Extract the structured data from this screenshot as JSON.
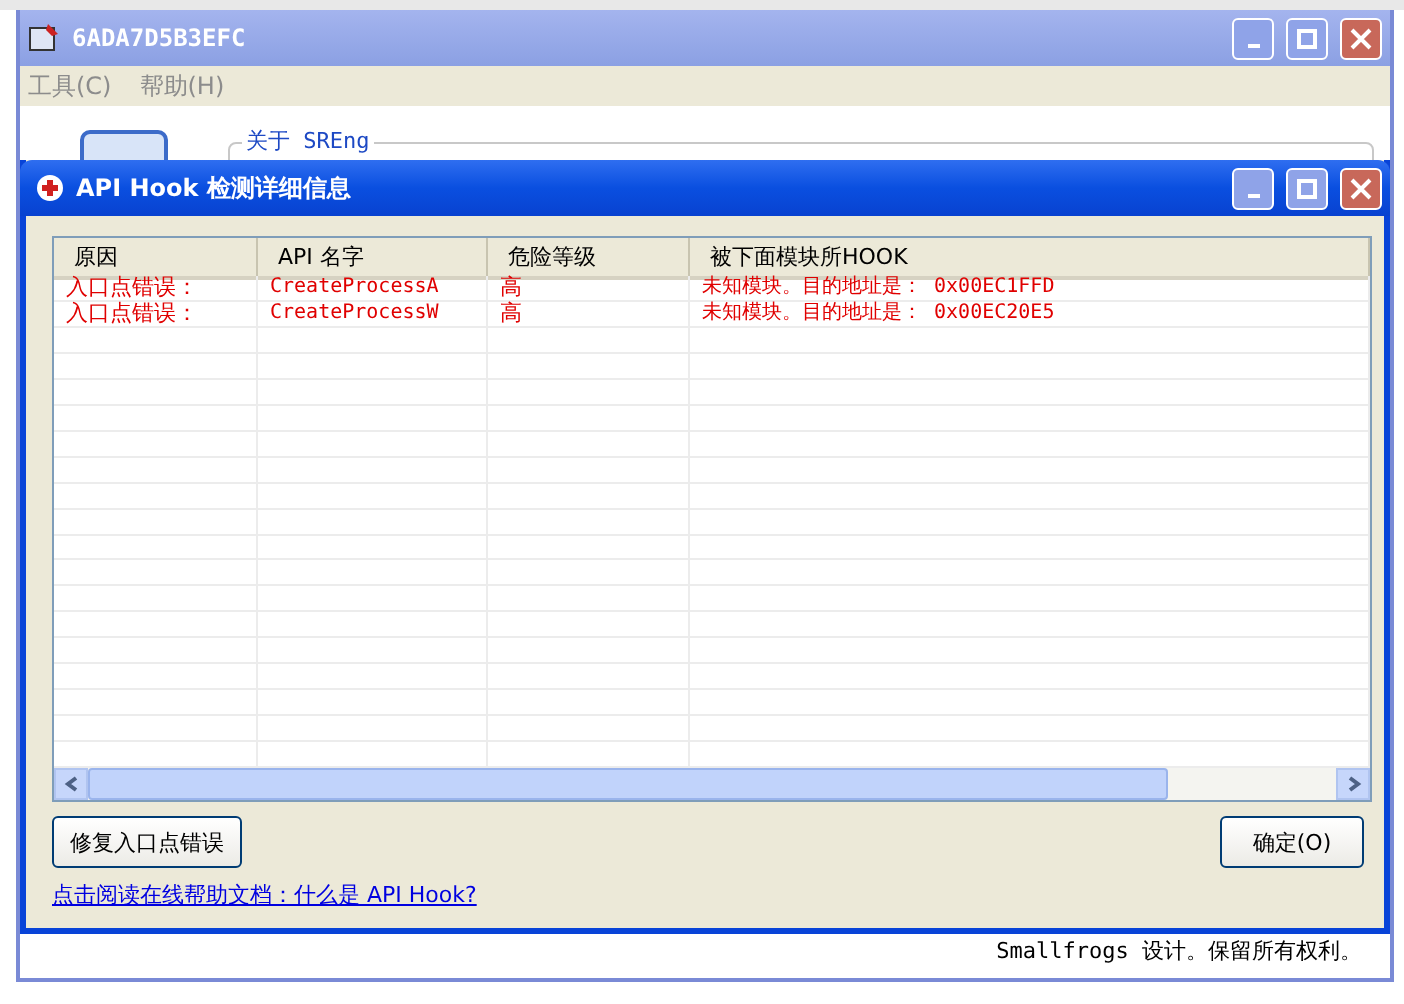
{
  "window": {
    "title": "6ADA7D5B3EFC"
  },
  "menu": [
    {
      "label": "工具(C)"
    },
    {
      "label": "帮助(H)"
    }
  ],
  "about_group": {
    "title": "关于 SREng"
  },
  "dialog": {
    "title": "API Hook 检测详细信息",
    "table": {
      "columns": [
        "原因",
        "API 名字",
        "危险等级",
        "被下面模块所HOOK"
      ],
      "rows": [
        [
          "入口点错误：",
          "CreateProcessA",
          "高",
          "未知模块。目的地址是： 0x00EC1FFD"
        ],
        [
          "入口点错误：",
          "CreateProcessW",
          "高",
          "未知模块。目的地址是： 0x00EC20E5"
        ]
      ]
    },
    "fix_button": "修复入口点错误",
    "ok_button": "确定(O)",
    "help_link": "点击阅读在线帮助文档：什么是 API Hook?"
  },
  "footer": "Smallfrogs 设计。保留所有权利。"
}
